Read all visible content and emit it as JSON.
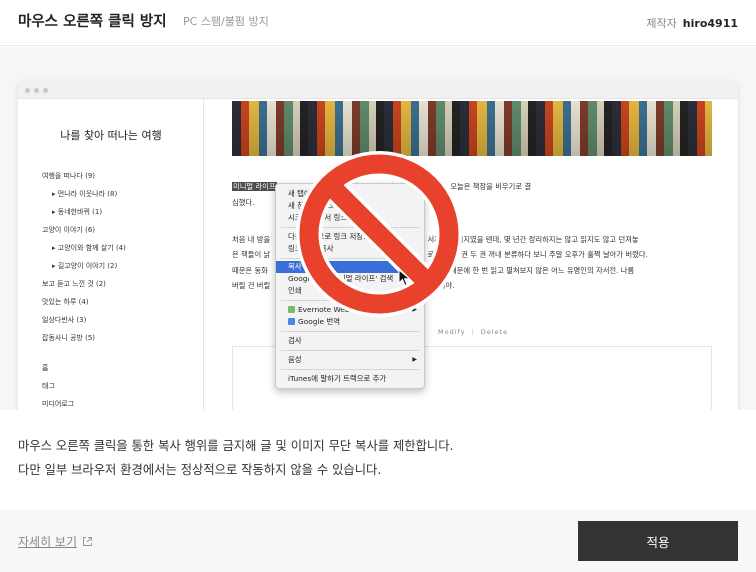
{
  "header": {
    "title": "마우스 오른쪽 클릭 방지",
    "subtitle": "PC 스팸/불펌 방지",
    "author_label": "제작자",
    "author_name": "hiro4911"
  },
  "preview": {
    "blog_title": "나를 찾아 떠나는 여행",
    "nav": [
      {
        "label": "여행을 떠나다 (9)",
        "child": false
      },
      {
        "label": "먼나라 이웃나라 (8)",
        "child": true
      },
      {
        "label": "동네한바퀴 (1)",
        "child": true
      },
      {
        "label": "고양이 이야기 (6)",
        "child": false
      },
      {
        "label": "고양이와 함께 살기 (4)",
        "child": true
      },
      {
        "label": "길고양이 이야기 (2)",
        "child": true
      },
      {
        "label": "보고 듣고 느낀 것 (2)",
        "child": false
      },
      {
        "label": "맛있는 하루 (4)",
        "child": false
      },
      {
        "label": "일상다반사 (3)",
        "child": false
      },
      {
        "label": "잡동사니 공방 (5)",
        "child": false
      }
    ],
    "nav_bottom": [
      "홈",
      "태그",
      "미디어로그"
    ],
    "article": {
      "highlight": "미니멀 라이프",
      "line1_rest": "          고자 청소하는 과정을 하나하나 남겨놓을까 한다. 오늘은 책장을 비우기로 결",
      "line2": "심했다.",
      "para2_lines": [
        "처음 내 방을                                                  인 오           서재의 이미지였을 텐데, 몇 년간 정리하지는 않고 읽지도 않고 던져놓",
        "은 책들이 낡                                                   는 기          로 책을 한 권 두 권 꺼내 분류하다 보니 주말 오후가 훌쩍 날아가 버렸다.",
        "때문은 동화                                                              하후감 숙제 때문에 한 번 읽고 펼쳐보지 않은 어느 유명인의 자서전. 나름",
        "버릴 건 버릴                                                               많을 줄이야."
      ]
    },
    "modify_label": "Modify",
    "delete_label": "Delete",
    "context_menu": {
      "items": [
        {
          "label": "새 탭에서 링크 열기"
        },
        {
          "label": "새 창에서 링크 열기"
        },
        {
          "label": "시크릿 창에서 링크 열기"
        },
        {
          "label": "다른 이름으로 링크 저장..."
        },
        {
          "label": "링크 주소 복사"
        },
        {
          "label": "복사"
        },
        {
          "label": "Google에서 '미니멀 라이프' 검색"
        },
        {
          "label": "인쇄"
        },
        {
          "label": "Evernote Web Clipper"
        },
        {
          "label": "Google 번역"
        },
        {
          "label": "검사"
        },
        {
          "label": "음성"
        },
        {
          "label": "iTunes에 말하기 트랙으로 추가"
        }
      ]
    }
  },
  "description": {
    "line1": "마우스 오른쪽 클릭을 통한 복사 행위를 금지해 글 및 이미지 무단 복사를 제한합니다.",
    "line2": "다만 일부 브라우저 환경에서는 정상적으로 작동하지 않을 수 있습니다."
  },
  "footer": {
    "more_label": "자세히 보기",
    "apply_label": "적용"
  },
  "colors": {
    "accent_button": "#333333",
    "prohibit_red": "#e8412c",
    "menu_highlight": "#3a6fd7"
  }
}
